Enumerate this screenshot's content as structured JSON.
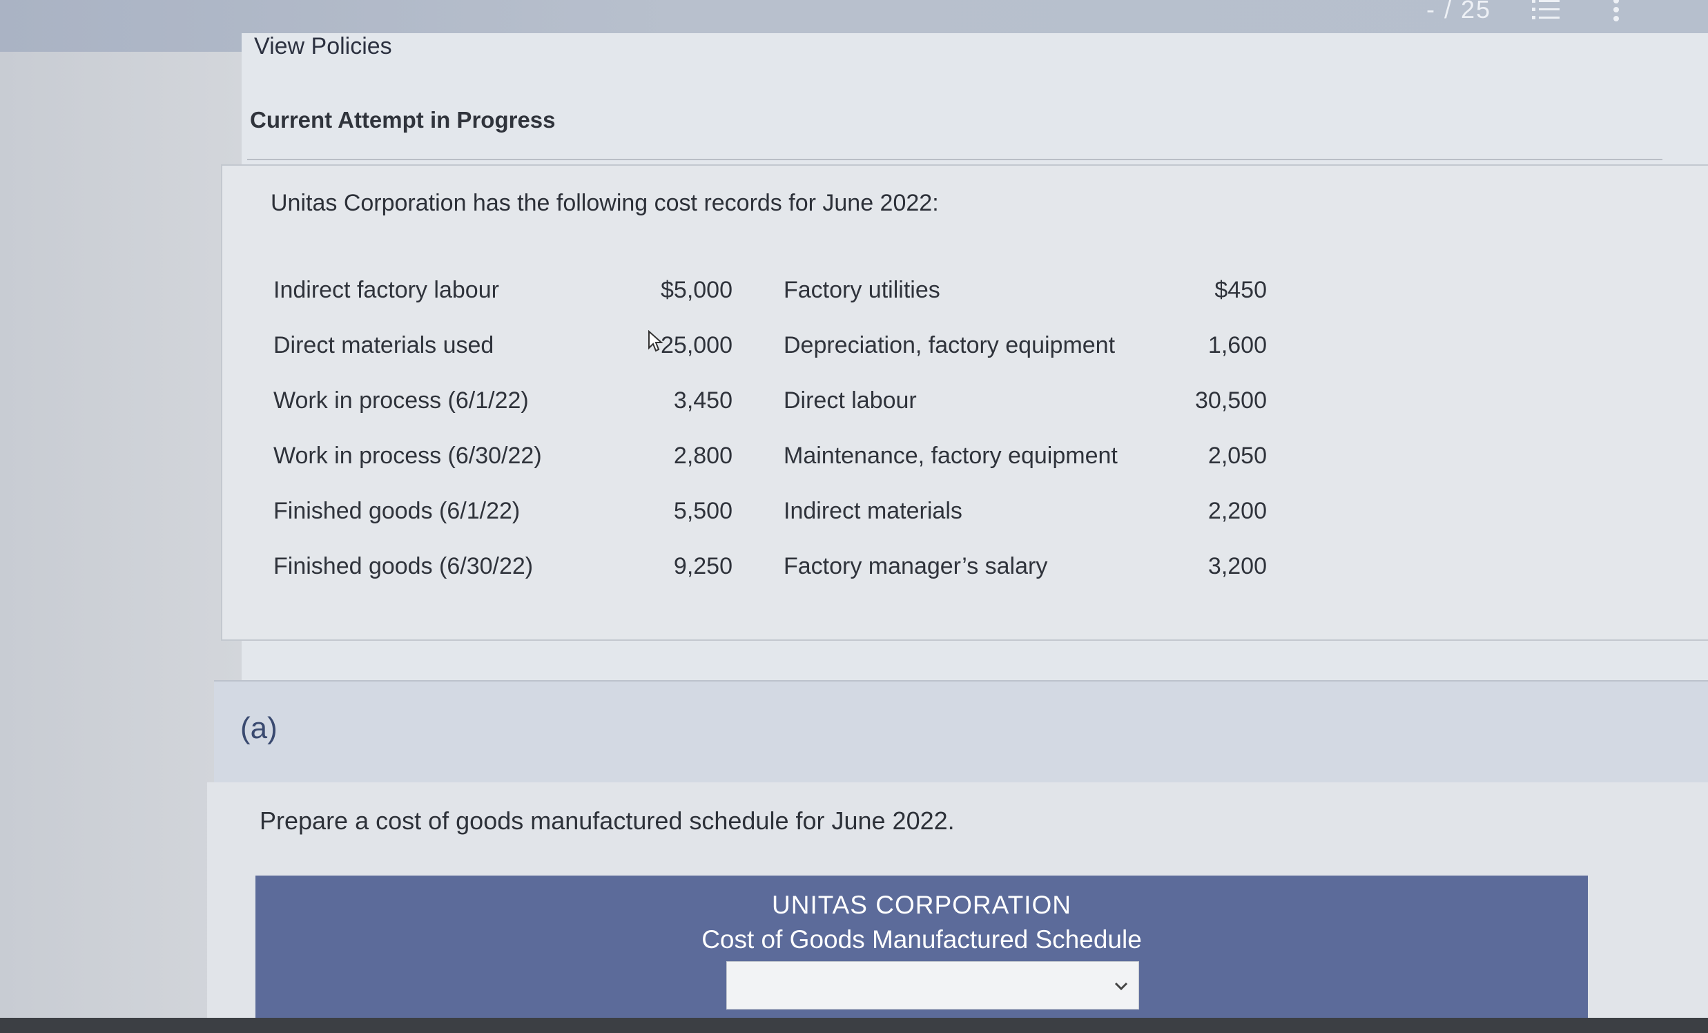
{
  "toolbar": {
    "page_count": "- / 25",
    "list_icon": "list-icon",
    "more_icon": "more-vertical-icon"
  },
  "header": {
    "view_policies": "View Policies",
    "attempt_label": "Current Attempt in Progress"
  },
  "problem": {
    "intro": "Unitas Corporation has the following cost records for June 2022:",
    "rows": [
      {
        "label": "Indirect factory labour",
        "amount": "$5,000",
        "label2": "Factory utilities",
        "amount2": "$450"
      },
      {
        "label": "Direct materials used",
        "amount": "25,000",
        "label2": "Depreciation, factory equipment",
        "amount2": "1,600"
      },
      {
        "label": "Work in process (6/1/22)",
        "amount": "3,450",
        "label2": "Direct labour",
        "amount2": "30,500"
      },
      {
        "label": "Work in process (6/30/22)",
        "amount": "2,800",
        "label2": "Maintenance, factory equipment",
        "amount2": "2,050"
      },
      {
        "label": "Finished goods (6/1/22)",
        "amount": "5,500",
        "label2": "Indirect materials",
        "amount2": "2,200"
      },
      {
        "label": "Finished goods (6/30/22)",
        "amount": "9,250",
        "label2": "Factory manager’s salary",
        "amount2": "3,200"
      }
    ]
  },
  "part_a": {
    "label": "(a)",
    "instruction": "Prepare a cost of goods manufactured schedule for June 2022.",
    "schedule": {
      "company": "UNITAS CORPORATION",
      "title": "Cost of Goods Manufactured Schedule",
      "period_select_value": ""
    }
  },
  "colors": {
    "schedule_header_bg": "#5c6b9a",
    "part_label": "#3a4a70"
  }
}
